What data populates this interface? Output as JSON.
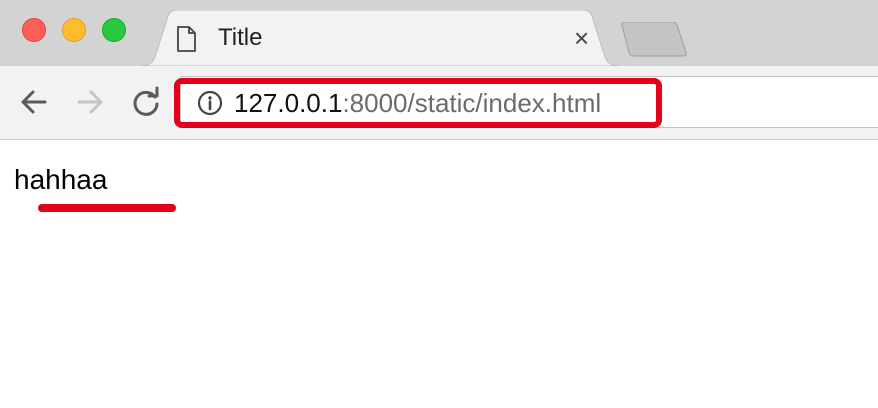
{
  "window": {
    "traffic_lights": {
      "close_color": "#fd5f57",
      "minimize_color": "#febc2e",
      "zoom_color": "#28c840"
    }
  },
  "tabs": {
    "active": {
      "title": "Title",
      "icon": "page-icon",
      "close_glyph": "×"
    },
    "new_tab_icon": "new-tab-icon"
  },
  "toolbar": {
    "back_icon": "back-arrow-icon",
    "forward_icon": "forward-arrow-icon",
    "reload_icon": "reload-icon"
  },
  "address_bar": {
    "security_icon": "info-icon",
    "url_host": "127.0.0.1",
    "url_rest": ":8000/static/index.html",
    "highlight_color": "#e3001b"
  },
  "page": {
    "text": "hahhaa",
    "underline_color": "#e3001b"
  }
}
